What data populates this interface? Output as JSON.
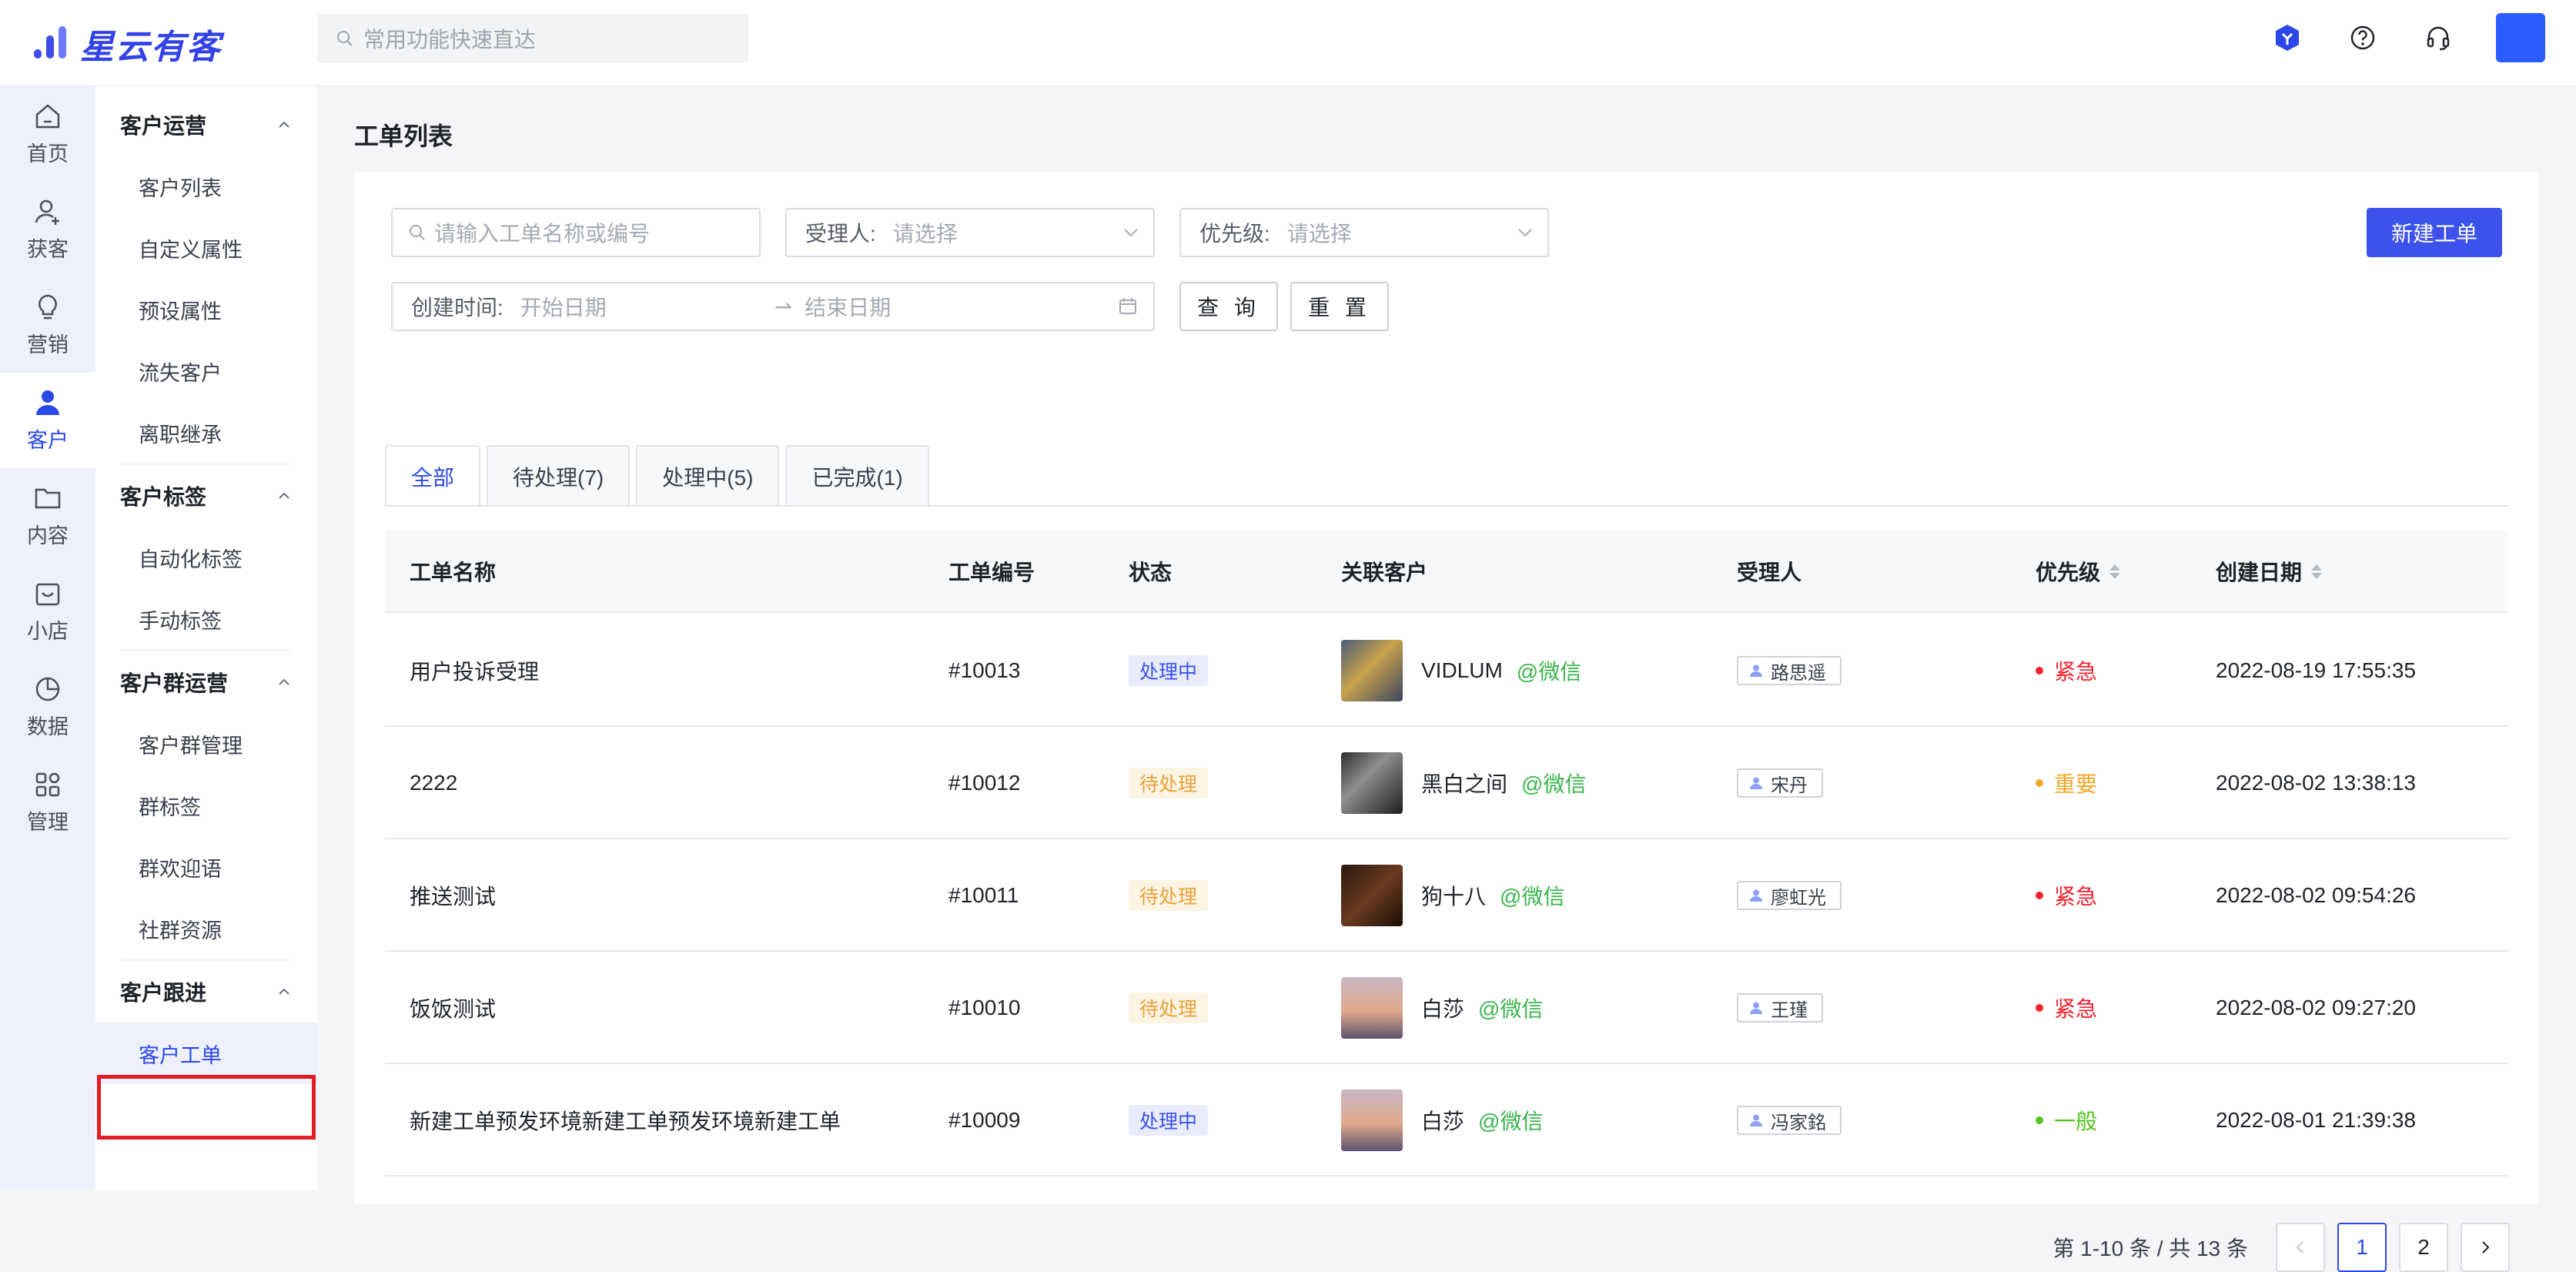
{
  "app": {
    "name": "星云有客",
    "brand_color": "#3342e6"
  },
  "top": {
    "search_placeholder": "常用功能快速直达",
    "icons": [
      "cube-badge-icon",
      "help-circle-icon",
      "headset-icon",
      "user-avatar"
    ]
  },
  "rail": {
    "items": [
      {
        "label": "首页",
        "icon": "home-icon"
      },
      {
        "label": "获客",
        "icon": "user-add-icon"
      },
      {
        "label": "营销",
        "icon": "bulb-icon"
      },
      {
        "label": "客户",
        "icon": "user-icon",
        "active": true
      },
      {
        "label": "内容",
        "icon": "folder-icon"
      },
      {
        "label": "小店",
        "icon": "shop-icon"
      },
      {
        "label": "数据",
        "icon": "pie-chart-icon"
      },
      {
        "label": "管理",
        "icon": "apps-icon"
      }
    ]
  },
  "menu": {
    "groups": [
      {
        "title": "客户运营",
        "items": [
          "客户列表",
          "自定义属性",
          "预设属性",
          "流失客户",
          "离职继承"
        ]
      },
      {
        "title": "客户标签",
        "items": [
          "自动化标签",
          "手动标签"
        ]
      },
      {
        "title": "客户群运营",
        "items": [
          "客户群管理",
          "群标签",
          "群欢迎语",
          "社群资源"
        ]
      },
      {
        "title": "客户跟进",
        "items": [
          "客户工单"
        ]
      }
    ],
    "selected": "客户工单"
  },
  "page": {
    "title": "工单列表"
  },
  "filters": {
    "search_placeholder": "请输入工单名称或编号",
    "assignee_label": "受理人:",
    "assignee_placeholder": "请选择",
    "priority_label": "优先级:",
    "priority_placeholder": "请选择",
    "date_label": "创建时间:",
    "start_placeholder": "开始日期",
    "end_placeholder": "结束日期",
    "query_button": "查 询",
    "reset_button": "重 置",
    "new_button": "新建工单"
  },
  "tabs": [
    "全部",
    "待处理(7)",
    "处理中(5)",
    "已完成(1)"
  ],
  "table": {
    "columns": [
      "工单名称",
      "工单编号",
      "状态",
      "关联客户",
      "受理人",
      "优先级",
      "创建日期"
    ],
    "rows": [
      {
        "name": "用户投诉受理",
        "id": "#10013",
        "status": "处理中",
        "customer": "VIDLUM",
        "channel": "@微信",
        "assignee": "路思遥",
        "priority": "紧急",
        "date": "2022-08-19 17:55:35"
      },
      {
        "name": "2222",
        "id": "#10012",
        "status": "待处理",
        "customer": "黑白之间",
        "channel": "@微信",
        "assignee": "宋丹",
        "priority": "重要",
        "date": "2022-08-02 13:38:13"
      },
      {
        "name": "推送测试",
        "id": "#10011",
        "status": "待处理",
        "customer": "狗十八",
        "channel": "@微信",
        "assignee": "廖虹光",
        "priority": "紧急",
        "date": "2022-08-02 09:54:26"
      },
      {
        "name": "饭饭测试",
        "id": "#10010",
        "status": "待处理",
        "customer": "白莎",
        "channel": "@微信",
        "assignee": "王瑾",
        "priority": "紧急",
        "date": "2022-08-02 09:27:20"
      },
      {
        "name": "新建工单预发环境新建工单预发环境新建工单",
        "id": "#10009",
        "status": "处理中",
        "customer": "白莎",
        "channel": "@微信",
        "assignee": "冯家銘",
        "priority": "一般",
        "date": "2022-08-01 21:39:38"
      }
    ]
  },
  "status_colors": {
    "处理中": {
      "bg": "#e8ecfd",
      "fg": "#3c52ea"
    },
    "待处理": {
      "bg": "#fdf4e3",
      "fg": "#e8a23a"
    }
  },
  "priority_colors": {
    "紧急": "#f5222d",
    "重要": "#f5a623",
    "一般": "#52c41a"
  },
  "pagination": {
    "summary": "第 1-10 条 / 共 13 条",
    "pages": [
      "1",
      "2"
    ],
    "current": "1"
  }
}
